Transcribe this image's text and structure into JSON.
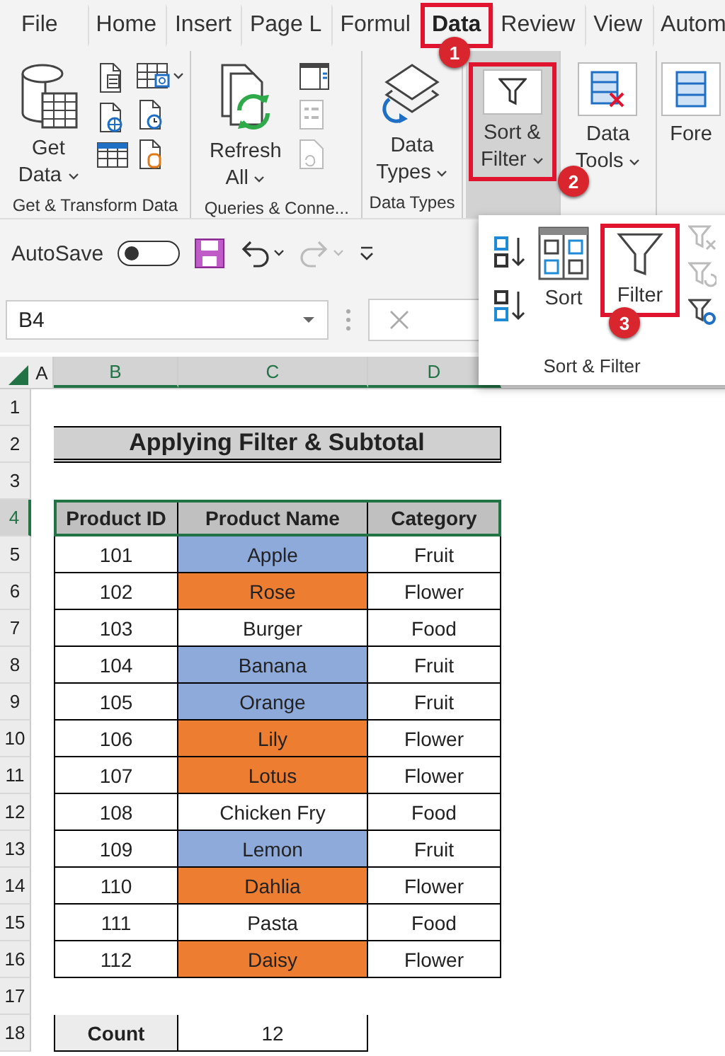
{
  "tabs": [
    {
      "label": "File",
      "selected": false,
      "highlighted": false
    },
    {
      "label": "Home",
      "selected": false,
      "highlighted": false
    },
    {
      "label": "Insert",
      "selected": false,
      "highlighted": false
    },
    {
      "label": "Page L",
      "selected": false,
      "highlighted": false
    },
    {
      "label": "Formul",
      "selected": false,
      "highlighted": false
    },
    {
      "label": "Data",
      "selected": true,
      "highlighted": true,
      "badge": "1"
    },
    {
      "label": "Review",
      "selected": false,
      "highlighted": false
    },
    {
      "label": "View",
      "selected": false,
      "highlighted": false
    },
    {
      "label": "Autom",
      "selected": false,
      "highlighted": false
    }
  ],
  "ribbon": {
    "groups": [
      {
        "kind": "get_transform",
        "button": "Get Data",
        "label": "Get & Transform Data"
      },
      {
        "kind": "queries",
        "button": "Refresh All",
        "label": "Queries & Conne..."
      },
      {
        "kind": "data_types",
        "button": "Data Types",
        "label": "Data Types"
      },
      {
        "kind": "sort_filter",
        "button": "Sort & Filter",
        "expanded": true,
        "highlighted": true,
        "badge": "2"
      },
      {
        "kind": "data_tools",
        "button": "Data Tools"
      },
      {
        "kind": "forecast",
        "button": "Fore"
      }
    ]
  },
  "quick_access": {
    "autosave_label": "AutoSave",
    "autosave_on": false
  },
  "formula_bar": {
    "name_box": "B4"
  },
  "sort_filter_menu": {
    "sort_button": "Sort",
    "filter_button": "Filter",
    "filter_highlighted": true,
    "filter_badge": "3",
    "label": "Sort & Filter"
  },
  "sheet": {
    "columns": [
      {
        "label": "A",
        "selected": false
      },
      {
        "label": "B",
        "selected": true
      },
      {
        "label": "C",
        "selected": true
      },
      {
        "label": "D",
        "selected": true
      }
    ],
    "rows": [
      {
        "number": "1",
        "selected": false,
        "kind": "empty"
      },
      {
        "number": "2",
        "selected": false,
        "kind": "title",
        "text": "Applying Filter & Subtotal"
      },
      {
        "number": "3",
        "selected": false,
        "kind": "empty"
      },
      {
        "number": "4",
        "selected": true,
        "kind": "header",
        "cells": [
          "Product ID",
          "Product Name",
          "Category"
        ]
      },
      {
        "number": "5",
        "selected": false,
        "kind": "data",
        "cells": [
          "101",
          "Apple",
          "Fruit"
        ],
        "color": "#8eaadb"
      },
      {
        "number": "6",
        "selected": false,
        "kind": "data",
        "cells": [
          "102",
          "Rose",
          "Flower"
        ],
        "color": "#ed7d31"
      },
      {
        "number": "7",
        "selected": false,
        "kind": "data",
        "cells": [
          "103",
          "Burger",
          "Food"
        ]
      },
      {
        "number": "8",
        "selected": false,
        "kind": "data",
        "cells": [
          "104",
          "Banana",
          "Fruit"
        ],
        "color": "#8eaadb"
      },
      {
        "number": "9",
        "selected": false,
        "kind": "data",
        "cells": [
          "105",
          "Orange",
          "Fruit"
        ],
        "color": "#8eaadb"
      },
      {
        "number": "10",
        "selected": false,
        "kind": "data",
        "cells": [
          "106",
          "Lily",
          "Flower"
        ],
        "color": "#ed7d31"
      },
      {
        "number": "11",
        "selected": false,
        "kind": "data",
        "cells": [
          "107",
          "Lotus",
          "Flower"
        ],
        "color": "#ed7d31"
      },
      {
        "number": "12",
        "selected": false,
        "kind": "data",
        "cells": [
          "108",
          "Chicken Fry",
          "Food"
        ]
      },
      {
        "number": "13",
        "selected": false,
        "kind": "data",
        "cells": [
          "109",
          "Lemon",
          "Fruit"
        ],
        "color": "#8eaadb"
      },
      {
        "number": "14",
        "selected": false,
        "kind": "data",
        "cells": [
          "110",
          "Dahlia",
          "Flower"
        ],
        "color": "#ed7d31"
      },
      {
        "number": "15",
        "selected": false,
        "kind": "data",
        "cells": [
          "111",
          "Pasta",
          "Food"
        ]
      },
      {
        "number": "16",
        "selected": false,
        "kind": "data",
        "cells": [
          "112",
          "Daisy",
          "Flower"
        ],
        "color": "#ed7d31"
      },
      {
        "number": "17",
        "selected": false,
        "kind": "empty"
      },
      {
        "number": "18",
        "selected": false,
        "kind": "total",
        "cells": [
          "Count",
          "12"
        ]
      }
    ]
  }
}
